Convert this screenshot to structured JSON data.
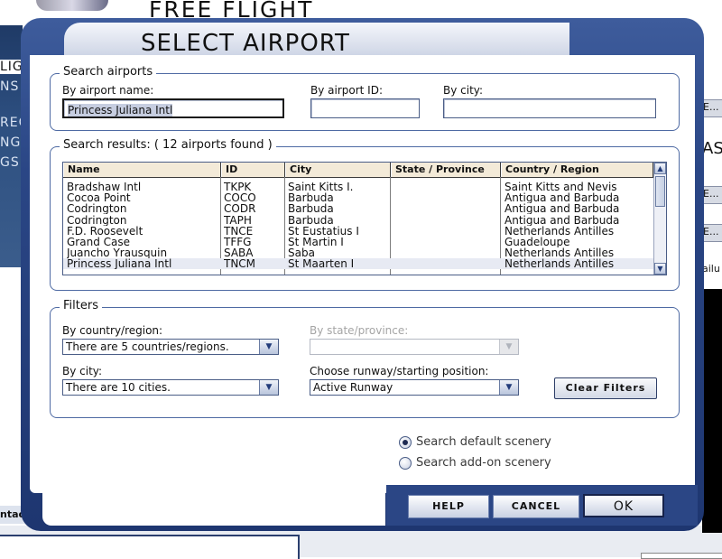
{
  "background": {
    "app_title": "FREE FLIGHT",
    "left_labels": [
      "LIG",
      "NS",
      "REC",
      "NG",
      "GS"
    ],
    "contacts_label": "ntacts",
    "right_fragments": [
      "E...",
      "E...",
      "E...",
      "ailu"
    ],
    "right_big": "ASC"
  },
  "dialog": {
    "title": "SELECT AIRPORT",
    "search": {
      "group_label": "Search airports",
      "name_label": "By airport name:",
      "name_value": "Princess Juliana Intl",
      "id_label": "By airport ID:",
      "id_value": "",
      "city_label": "By city:",
      "city_value": ""
    },
    "results": {
      "group_label": "Search results: ( 12 airports found )",
      "columns": [
        "Name",
        "ID",
        "City",
        "State / Province",
        "Country / Region"
      ],
      "rows": [
        {
          "name": "Bradshaw Intl",
          "id": "TKPK",
          "city": "Saint Kitts I.",
          "state": "",
          "country": "Saint Kitts and Nevis"
        },
        {
          "name": "Cocoa Point",
          "id": "COCO",
          "city": "Barbuda",
          "state": "",
          "country": "Antigua and Barbuda"
        },
        {
          "name": "Codrington",
          "id": "CODR",
          "city": "Barbuda",
          "state": "",
          "country": "Antigua and Barbuda"
        },
        {
          "name": "Codrington",
          "id": "TAPH",
          "city": "Barbuda",
          "state": "",
          "country": "Antigua and Barbuda"
        },
        {
          "name": "F.D. Roosevelt",
          "id": "TNCE",
          "city": "St Eustatius I",
          "state": "",
          "country": "Netherlands Antilles"
        },
        {
          "name": "Grand Case",
          "id": "TFFG",
          "city": "St Martin I",
          "state": "",
          "country": "Guadeloupe"
        },
        {
          "name": "Juancho Yrausquin",
          "id": "SABA",
          "city": "Saba",
          "state": "",
          "country": "Netherlands Antilles"
        },
        {
          "name": "Princess Juliana Intl",
          "id": "TNCM",
          "city": "St Maarten I",
          "state": "",
          "country": "Netherlands Antilles"
        }
      ],
      "selected_row": 7
    },
    "filters": {
      "group_label": "Filters",
      "country_label": "By country/region:",
      "country_value": "There are 5 countries/regions.",
      "state_label": "By state/province:",
      "state_value": "",
      "city_label": "By city:",
      "city_value": "There are 10 cities.",
      "runway_label": "Choose runway/starting position:",
      "runway_value": "Active Runway",
      "clear_label": "Clear Filters"
    },
    "scenery": {
      "default_label": "Search default scenery",
      "addon_label": "Search add-on scenery",
      "selected": "default"
    },
    "buttons": {
      "help": "HELP",
      "cancel": "CANCEL",
      "ok": "OK"
    }
  }
}
